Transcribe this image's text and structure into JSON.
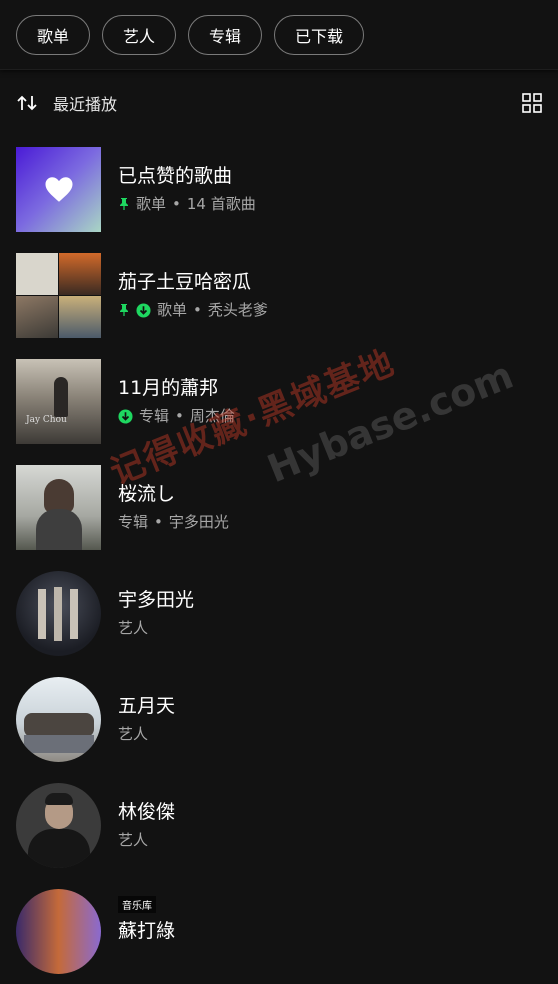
{
  "filters": [
    "歌单",
    "艺人",
    "专辑",
    "已下载"
  ],
  "sort": {
    "label": "最近播放"
  },
  "items": [
    {
      "title": "已点赞的歌曲",
      "type": "歌单",
      "detail": "14 首歌曲"
    },
    {
      "title": "茄子土豆哈密瓜",
      "type": "歌单",
      "detail": "秃头老爹"
    },
    {
      "title": "11月的蕭邦",
      "type": "专辑",
      "detail": "周杰倫"
    },
    {
      "title": "桜流し",
      "type": "专辑",
      "detail": "宇多田光"
    },
    {
      "title": "宇多田光",
      "type": "艺人"
    },
    {
      "title": "五月天",
      "type": "艺人"
    },
    {
      "title": "林俊傑",
      "type": "艺人"
    },
    {
      "title": "蘇打綠"
    }
  ],
  "watermark_cn": "记得收藏·黑域基地",
  "watermark_en": "Hybase.com",
  "tooltip": "音乐库",
  "colors": {
    "accent": "#1ed760",
    "bg": "#121212",
    "sub": "#a7a7a7"
  }
}
